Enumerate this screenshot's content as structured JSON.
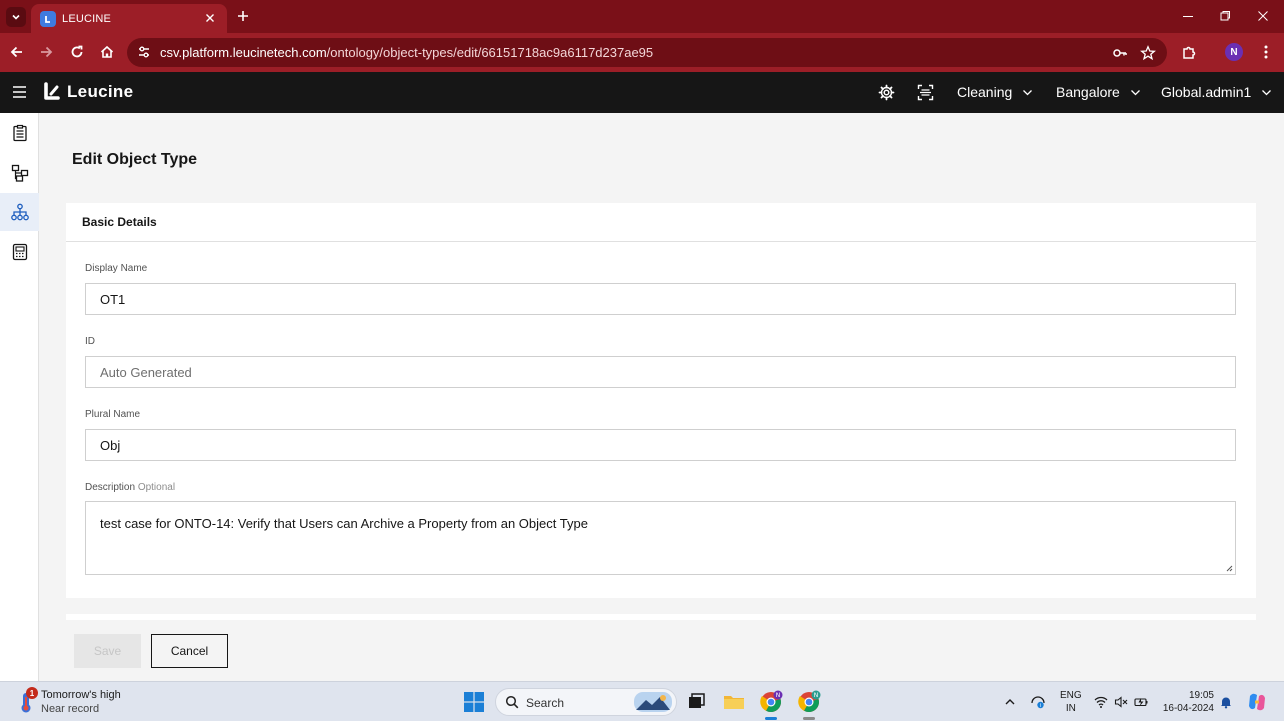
{
  "browser": {
    "tab_title": "LEUCINE",
    "url_host": "csv.platform.leucinetech.com",
    "url_path": "/ontology/object-types/edit/66151718ac9a6117d237ae95",
    "profile_initial": "N"
  },
  "header": {
    "brand": "Leucine",
    "facility": "Cleaning",
    "location": "Bangalore",
    "user": "Global.admin1"
  },
  "page": {
    "title": "Edit Object Type",
    "section_title": "Basic Details",
    "fields": {
      "display_name": {
        "label": "Display Name",
        "value": "OT1"
      },
      "id": {
        "label": "ID",
        "placeholder": "Auto Generated"
      },
      "plural_name": {
        "label": "Plural Name",
        "value": "Obj"
      },
      "description": {
        "label": "Description",
        "optional": "Optional",
        "value": "test case for ONTO-14: Verify that Users can Archive a Property from an Object Type"
      }
    },
    "actions": {
      "save": "Save",
      "cancel": "Cancel"
    }
  },
  "taskbar": {
    "weather_badge": "1",
    "weather_title": "Tomorrow's high",
    "weather_subtitle": "Near record",
    "search_label": "Search",
    "lang_1": "ENG",
    "lang_2": "IN",
    "time": "19:05",
    "date": "16-04-2024"
  },
  "colors": {
    "browser_frame": "#9c1e27",
    "app_header": "#161616",
    "active_rail": "#e8eef8",
    "accent": "#1f5fbf"
  },
  "icons": {
    "rail": [
      "checklist-icon",
      "hierarchy-icon",
      "ontology-icon",
      "reports-icon"
    ],
    "header": [
      "settings-gear-icon",
      "scan-icon"
    ]
  }
}
